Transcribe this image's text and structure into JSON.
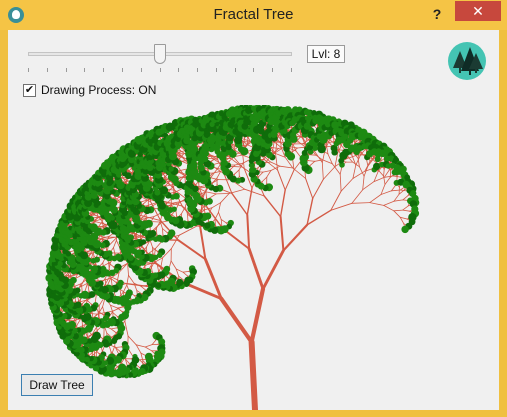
{
  "window": {
    "title": "Fractal Tree",
    "help_label": "?",
    "close_label": "✕"
  },
  "controls": {
    "slider": {
      "value": 8,
      "min": 0,
      "max": 14
    },
    "level_label": "Lvl: 8",
    "checkbox_checked": true,
    "checkbox_mark": "✔",
    "checkbox_label": "Drawing Process: ON",
    "draw_button": "Draw Tree"
  },
  "tree": {
    "trunk_color": "#d35a45",
    "leaf_color": "#1d8a12",
    "leaf_dark": "#0f6d0a"
  },
  "icons": {
    "app": "app-icon",
    "logo": "tree-logo-icon"
  }
}
